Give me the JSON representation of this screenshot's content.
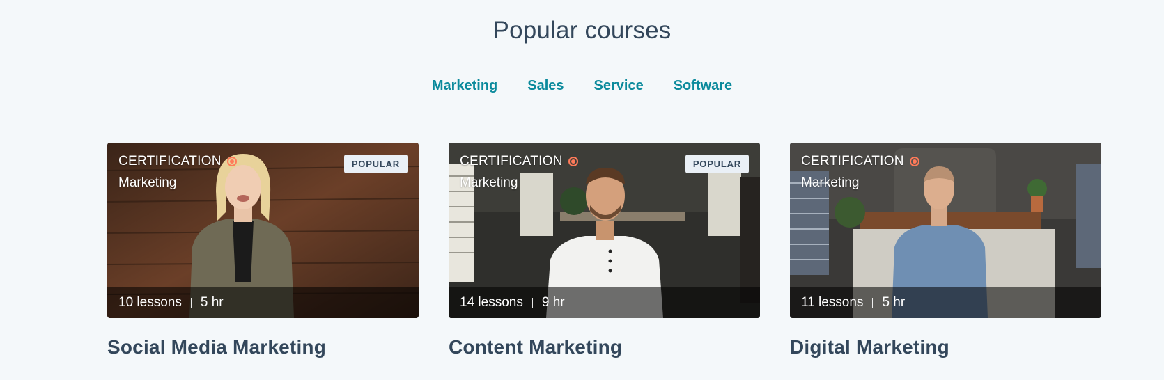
{
  "section": {
    "title": "Popular courses"
  },
  "tabs": [
    {
      "label": "Marketing"
    },
    {
      "label": "Sales"
    },
    {
      "label": "Service"
    },
    {
      "label": "Software"
    }
  ],
  "cards": [
    {
      "type_label": "CERTIFICATION",
      "category": "Marketing",
      "badge": "POPULAR",
      "lessons": "10 lessons",
      "duration": "5 hr",
      "title": "Social Media Marketing"
    },
    {
      "type_label": "CERTIFICATION",
      "category": "Marketing",
      "badge": "POPULAR",
      "lessons": "14 lessons",
      "duration": "9 hr",
      "title": "Content Marketing"
    },
    {
      "type_label": "CERTIFICATION",
      "category": "Marketing",
      "badge": "",
      "lessons": "11 lessons",
      "duration": "5 hr",
      "title": "Digital Marketing"
    }
  ],
  "colors": {
    "background": "#f4f8fa",
    "heading": "#33475b",
    "tab_link": "#0b8a9c",
    "cert_accent": "#ff7a59",
    "badge_bg": "#eaf0f6"
  }
}
